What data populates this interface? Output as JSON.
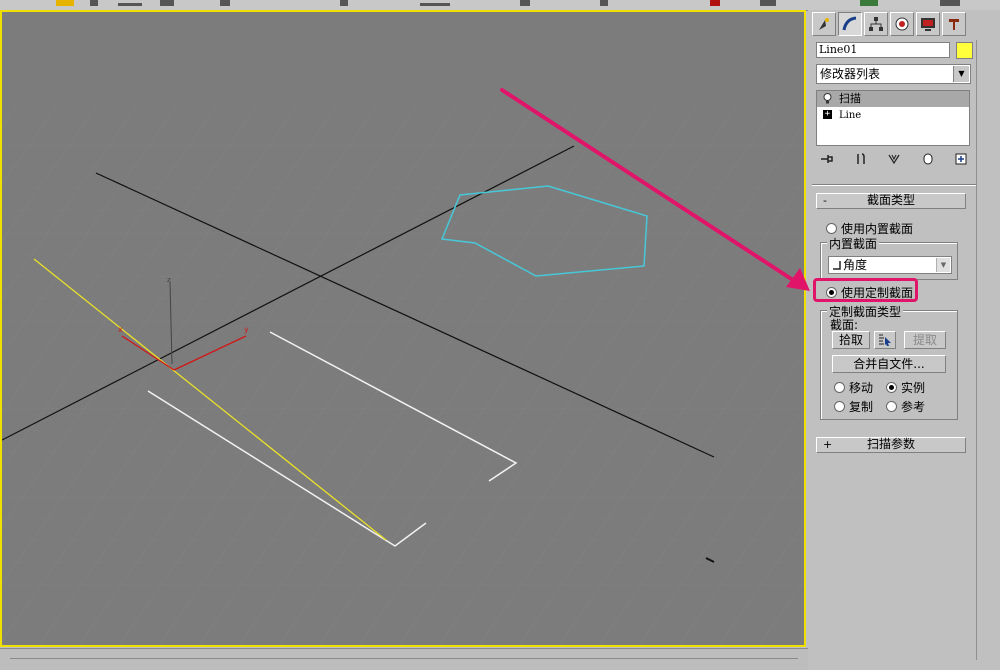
{
  "panel": {
    "object_name": "Line01",
    "object_color": "#ffff3c",
    "modifier_list_label": "修改器列表",
    "stack": [
      {
        "label": "扫描",
        "icon": "lightbulb-icon"
      },
      {
        "label": "Line",
        "icon": "plus-expand-icon"
      }
    ],
    "section_type_rollout": {
      "title": "截面类型",
      "collapse_sign": "-",
      "use_builtin_label": "使用内置截面",
      "builtin_group_title": "内置截面",
      "builtin_value": "角度",
      "use_custom_label": "使用定制截面",
      "custom_group_title": "定制截面类型",
      "section_label": "截面:",
      "pick_button": "拾取",
      "extract_button": "提取",
      "merge_button": "合并自文件...",
      "move_label": "移动",
      "instance_label": "实例",
      "copy_label": "复制",
      "reference_label": "参考"
    },
    "sweep_params_rollout": {
      "title": "扫描参数",
      "expand_sign": "+"
    }
  },
  "accent_colors": {
    "viewport_border": "#f0e000",
    "annotation": "#e0156a",
    "star_shape": "#47c8d8"
  }
}
